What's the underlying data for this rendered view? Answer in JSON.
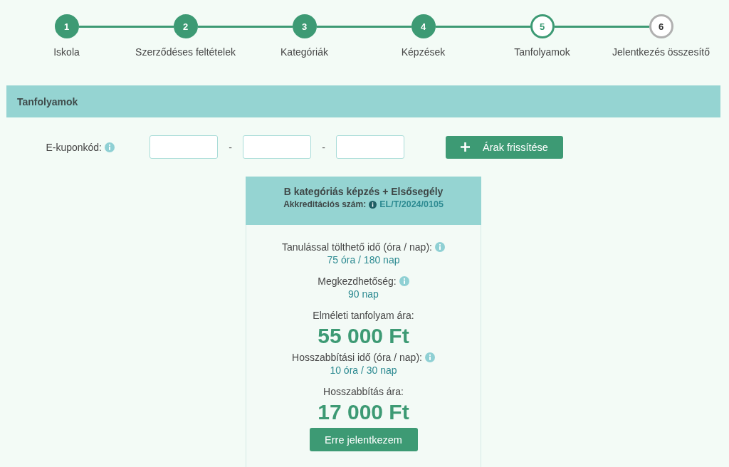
{
  "steps": [
    {
      "number": "1",
      "label": "Iskola",
      "completed": true,
      "selected": false
    },
    {
      "number": "2",
      "label": "Szerződéses feltételek",
      "completed": true,
      "selected": false
    },
    {
      "number": "3",
      "label": "Kategóriák",
      "completed": true,
      "selected": false
    },
    {
      "number": "4",
      "label": "Képzések",
      "completed": true,
      "selected": false
    },
    {
      "number": "5",
      "label": "Tanfolyamok",
      "completed": false,
      "selected": true
    },
    {
      "number": "6",
      "label": "Jelentkezés összesítő",
      "completed": false,
      "selected": false
    }
  ],
  "section": {
    "title": "Tanfolyamok"
  },
  "coupon": {
    "label": "E-kuponkód:",
    "info": true,
    "separators": [
      "-",
      "-"
    ],
    "button": "Árak frissítése"
  },
  "course": {
    "title": "B kategóriás képzés + Elsősegély",
    "accreditation_label": "Akkreditációs szám:",
    "accreditation_number": "EL/T/2024/0105",
    "details": [
      {
        "kind": "duration",
        "label": "Tanulással tölthető idő (óra / nap):",
        "info": true,
        "value": "75 óra / 180 nap"
      },
      {
        "kind": "duration",
        "label": "Megkezdhetőség:",
        "info": true,
        "value": "90 nap"
      },
      {
        "kind": "price",
        "label": "Elméleti tanfolyam ára:",
        "info": false,
        "value": "55 000 Ft"
      },
      {
        "kind": "duration",
        "label": "Hosszabbítási idő (óra / nap):",
        "info": true,
        "value": "10 óra / 30 nap"
      },
      {
        "kind": "price",
        "label": "Hosszabbítás ára:",
        "info": false,
        "value": "17 000 Ft"
      }
    ],
    "button": "Erre jelentkezem"
  }
}
